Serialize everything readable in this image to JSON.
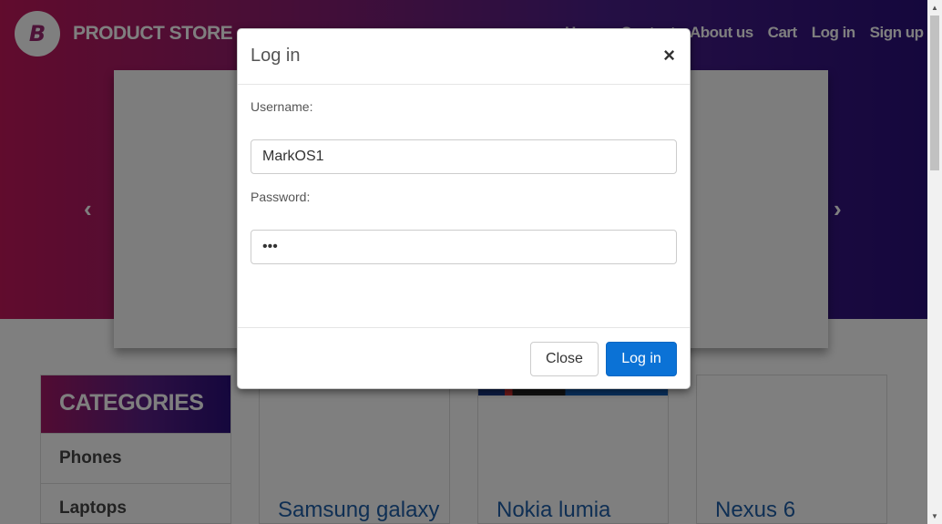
{
  "brand": {
    "logo_letter": "B",
    "name": "PRODUCT STORE"
  },
  "nav": {
    "home": "Home",
    "contact": "Contact",
    "about": "About us",
    "cart": "Cart",
    "login": "Log in",
    "signup": "Sign up"
  },
  "carousel": {
    "prev_icon": "‹",
    "next_icon": "›"
  },
  "categories": {
    "header": "CATEGORIES",
    "items": [
      "Phones",
      "Laptops"
    ]
  },
  "products": [
    {
      "title": "Samsung galaxy"
    },
    {
      "title": "Nokia lumia"
    },
    {
      "title": "Nexus 6"
    }
  ],
  "modal": {
    "title": "Log in",
    "close_icon": "×",
    "username_label": "Username:",
    "username_value": "MarkOS1",
    "password_label": "Password:",
    "password_value": "•••",
    "close_button": "Close",
    "login_button": "Log in"
  },
  "colors": {
    "accent": "#0b72d6",
    "brand_gradient_start": "#c2185b",
    "brand_gradient_end": "#2a0f7a",
    "link": "#1f5fa8"
  }
}
